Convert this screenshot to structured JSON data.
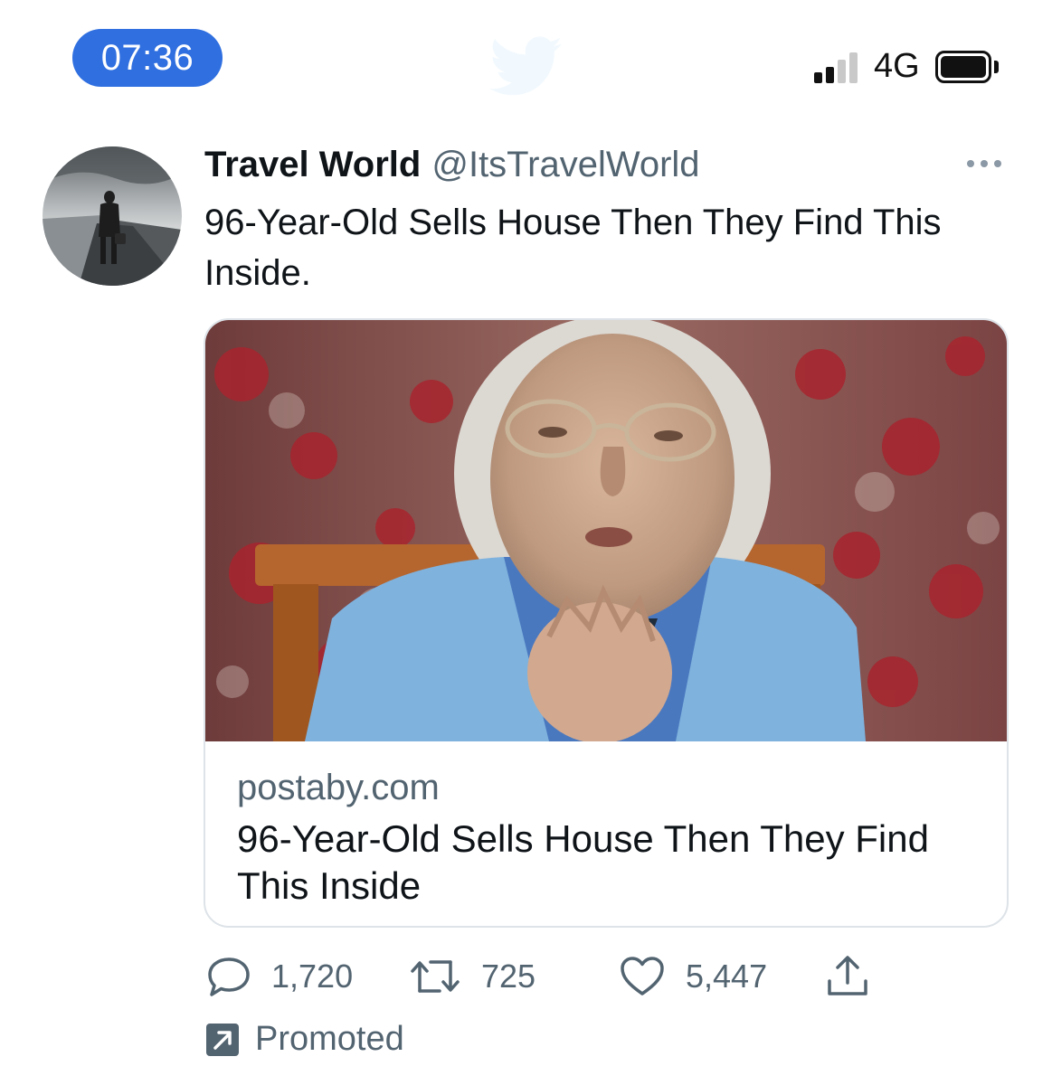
{
  "status_bar": {
    "time": "07:36",
    "network": "4G",
    "icons": [
      "signal-icon",
      "battery-icon"
    ]
  },
  "tweet": {
    "author_name": "Travel World",
    "author_handle": "@ItsTravelWorld",
    "text": "96-Year-Old Sells House Then They Find This Inside.",
    "card": {
      "domain": "postaby.com",
      "title": "96-Year-Old Sells House Then They Find This Inside"
    },
    "actions": {
      "replies": "1,720",
      "retweets": "725",
      "likes": "5,447"
    },
    "promoted_label": "Promoted"
  },
  "colors": {
    "time_pill": "#2f6fe0",
    "secondary_text": "#536471",
    "primary_text": "#0f1419",
    "card_border": "#dde3e8"
  }
}
